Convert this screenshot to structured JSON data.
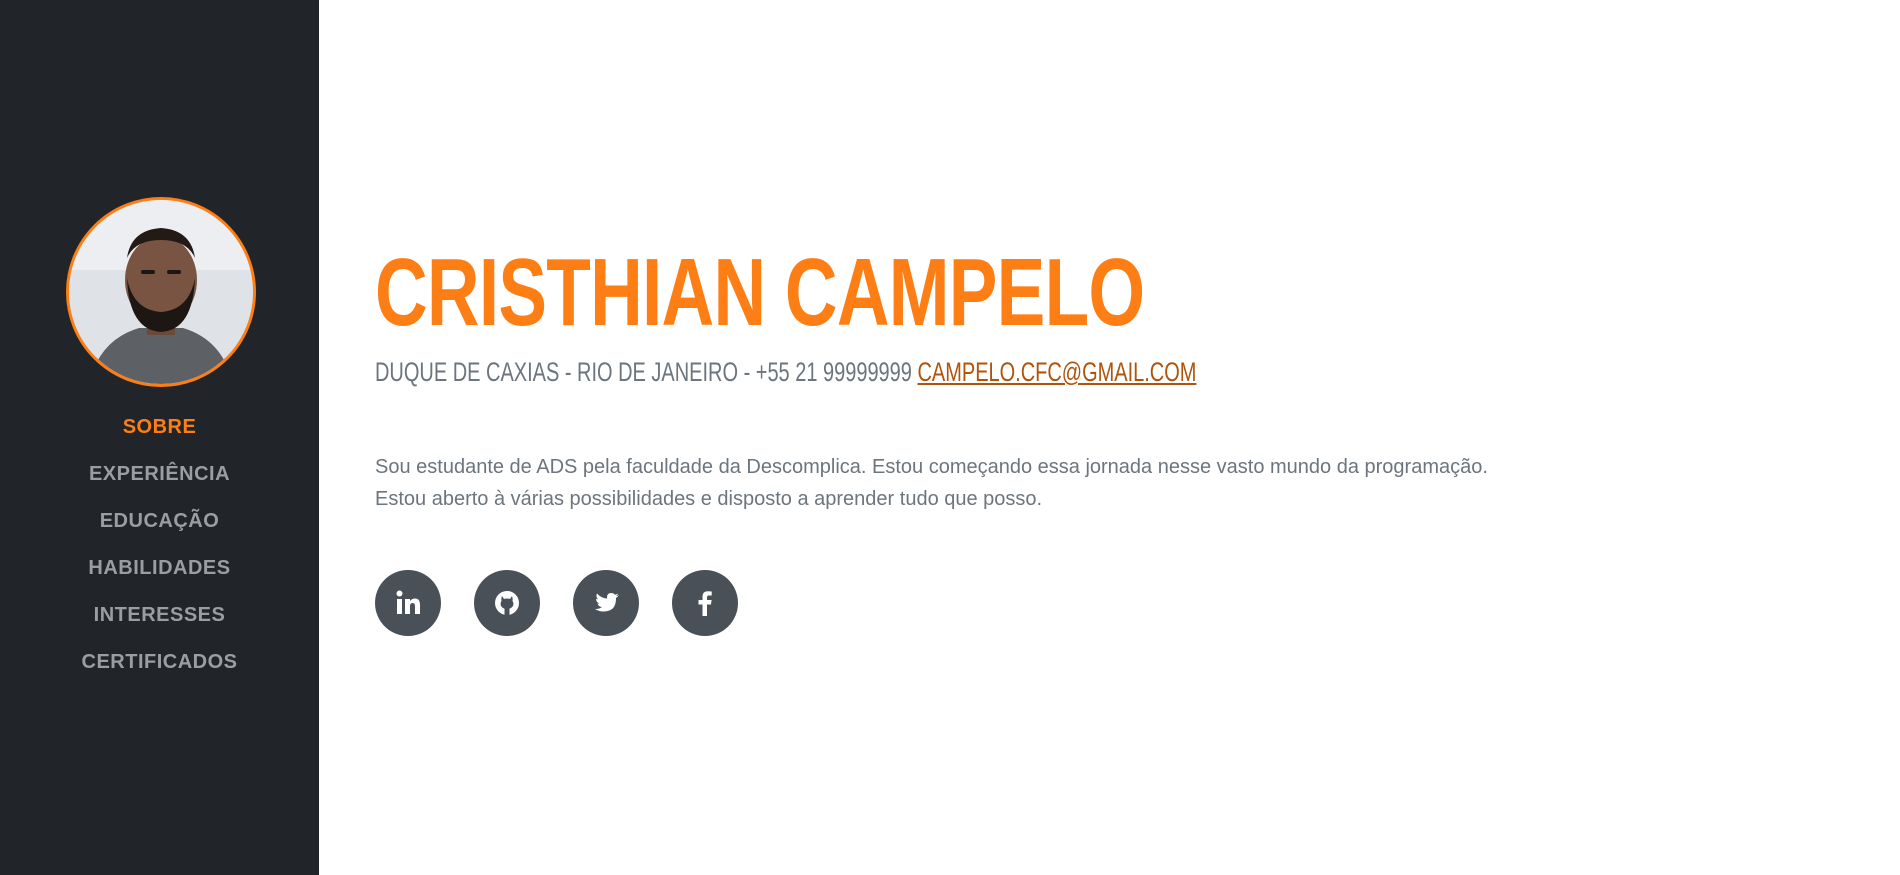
{
  "sidebar": {
    "avatar_icon": "profile-photo",
    "nav": [
      {
        "label": "SOBRE",
        "active": true
      },
      {
        "label": "EXPERIÊNCIA",
        "active": false
      },
      {
        "label": "EDUCAÇÃO",
        "active": false
      },
      {
        "label": "HABILIDADES",
        "active": false
      },
      {
        "label": "INTERESSES",
        "active": false
      },
      {
        "label": "CERTIFICADOS",
        "active": false
      }
    ]
  },
  "main": {
    "name": "CRISTHIAN CAMPELO",
    "location_phone": "DUQUE DE CAXIAS - RIO DE JANEIRO - +55 21 99999999",
    "email": "CAMPELO.CFC@GMAIL.COM",
    "bio_line1": "Sou estudante de ADS pela faculdade da Descomplica. Estou começando essa jornada nesse vasto mundo da programação.",
    "bio_line2": "Estou aberto à várias possibilidades e disposto a aprender tudo que posso.",
    "socials": [
      "linkedin-icon",
      "github-icon",
      "twitter-icon",
      "facebook-icon"
    ]
  },
  "colors": {
    "sidebar_bg": "#212529",
    "accent": "#fd7e14",
    "nav_text": "#9a9da1",
    "body_text": "#6c757d",
    "social_bg": "#495057",
    "link": "#b0530b"
  }
}
